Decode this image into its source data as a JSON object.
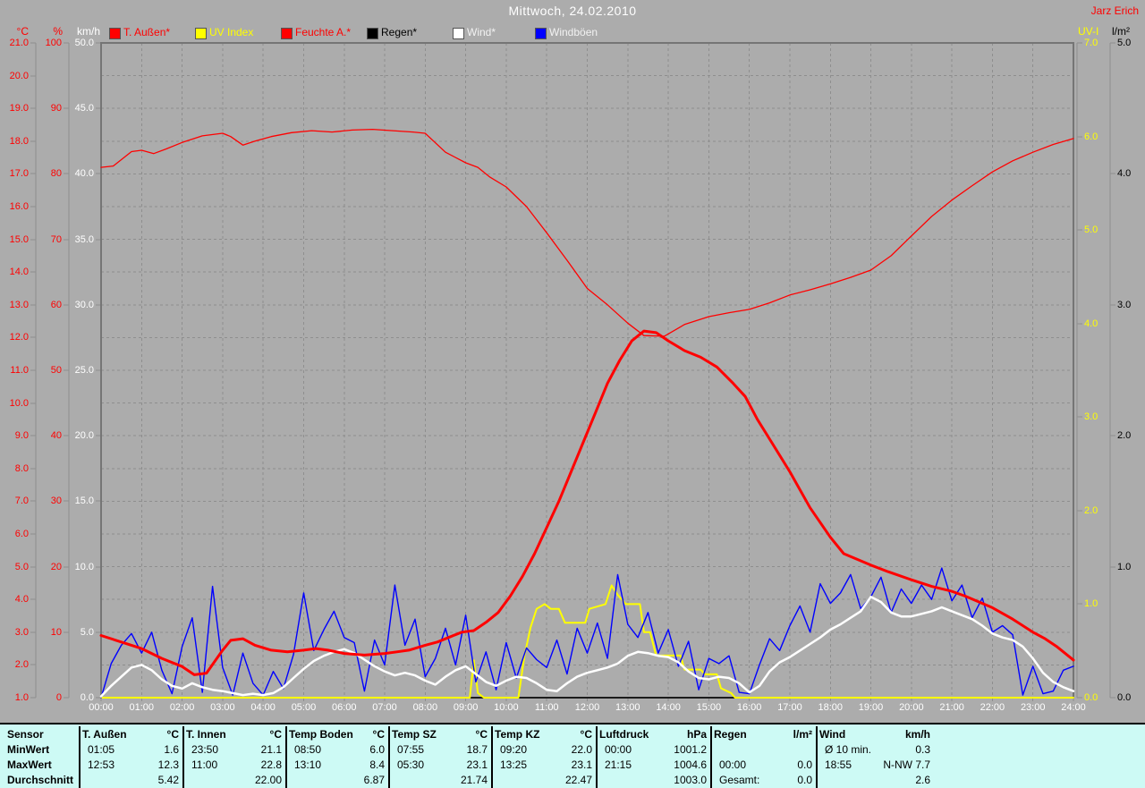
{
  "window": {
    "title": "Mittwoch, 24.02.2010",
    "author": "Jarz Erich"
  },
  "legend": {
    "items": [
      {
        "label": "T. Außen*",
        "swatch_color": "#ff0000",
        "text_color": "#ff0000"
      },
      {
        "label": "UV Index",
        "swatch_color": "#ffff00",
        "text_color": "#ffff00"
      },
      {
        "label": "Feuchte A.*",
        "swatch_color": "#ff0000",
        "text_color": "#ff0000"
      },
      {
        "label": "Regen*",
        "swatch_color": "#000000",
        "text_color": "#000000"
      },
      {
        "label": "Wind*",
        "swatch_color": "#ffffff",
        "text_color": "#f2f2f2"
      },
      {
        "label": "Windböen",
        "swatch_color": "#0000ff",
        "text_color": "#f2f2f2"
      }
    ]
  },
  "chart_data": {
    "type": "line",
    "title": "Mittwoch, 24.02.2010",
    "layout": {
      "plot_background": "#acacac",
      "grid": "dashed hourly x / 1-unit y",
      "legend_position": "top"
    },
    "x_axis": {
      "min": 0,
      "max": 24,
      "tick_labels": [
        "00:00",
        "01:00",
        "02:00",
        "03:00",
        "04:00",
        "05:00",
        "06:00",
        "07:00",
        "08:00",
        "09:00",
        "10:00",
        "11:00",
        "12:00",
        "13:00",
        "14:00",
        "15:00",
        "16:00",
        "17:00",
        "18:00",
        "19:00",
        "20:00",
        "21:00",
        "22:00",
        "23:00",
        "24:00"
      ]
    },
    "y_axes": [
      {
        "id": "temp_c",
        "unit": "°C",
        "side": "left",
        "min": 1,
        "max": 21,
        "step": 1,
        "decimals": 1,
        "color": "#ff0000"
      },
      {
        "id": "percent",
        "unit": "%",
        "side": "left",
        "min": 0,
        "max": 100,
        "step": 10,
        "decimals": 0,
        "color": "#ff0000"
      },
      {
        "id": "kmh",
        "unit": "km/h",
        "side": "left",
        "min": 0,
        "max": 50,
        "step": 5,
        "decimals": 1,
        "color": "#ffffff"
      },
      {
        "id": "uv",
        "unit": "UV-I",
        "side": "right",
        "min": 0,
        "max": 7,
        "step": 1,
        "decimals": 1,
        "color": "#ffff00"
      },
      {
        "id": "lm2",
        "unit": "l/m²",
        "side": "right",
        "min": 0,
        "max": 5,
        "step": 1,
        "decimals": 1,
        "color": "#000000"
      }
    ],
    "series": [
      {
        "name": "Regen",
        "axis": "lm2",
        "color": "#000000",
        "width": 1.5,
        "x": [
          0,
          24
        ],
        "values": [
          0,
          0
        ]
      },
      {
        "name": "UV Index",
        "axis": "uv",
        "color": "#ffff00",
        "width": 2,
        "x": [
          0,
          9.1,
          9.2,
          9.3,
          9.45,
          10.3,
          10.45,
          10.6,
          10.75,
          10.95,
          11.1,
          11.3,
          11.45,
          11.5,
          11.95,
          12.05,
          12.45,
          12.6,
          12.75,
          12.95,
          13.1,
          13.3,
          13.4,
          13.55,
          13.7,
          13.8,
          14.3,
          14.4,
          14.8,
          14.9,
          15.2,
          15.3,
          15.55,
          15.65,
          24
        ],
        "values": [
          0,
          0,
          0.4,
          0.05,
          0,
          0,
          0.45,
          0.75,
          0.95,
          1.0,
          0.95,
          0.95,
          0.8,
          0.8,
          0.8,
          0.95,
          1.0,
          1.2,
          1.1,
          1.0,
          1.0,
          1.0,
          0.7,
          0.7,
          0.45,
          0.45,
          0.45,
          0.3,
          0.3,
          0.25,
          0.25,
          0.1,
          0.05,
          0,
          0
        ]
      },
      {
        "name": "Windböen",
        "axis": "kmh",
        "color": "#0000ff",
        "width": 1.4,
        "x_start": 0,
        "x_step": 0.25,
        "values": [
          0.0,
          2.6,
          4.0,
          4.9,
          3.4,
          5.0,
          2.1,
          0.3,
          3.9,
          6.1,
          0.4,
          8.5,
          2.3,
          0.2,
          3.4,
          1.1,
          0.2,
          2.0,
          0.7,
          3.3,
          8.0,
          3.6,
          5.2,
          6.6,
          4.6,
          4.2,
          0.5,
          4.4,
          2.5,
          8.6,
          4.0,
          6.0,
          1.6,
          3.0,
          5.3,
          2.5,
          6.3,
          1.2,
          3.5,
          0.6,
          4.2,
          1.5,
          3.8,
          2.9,
          2.3,
          4.4,
          1.8,
          5.3,
          3.4,
          5.7,
          3.0,
          9.4,
          5.6,
          4.6,
          6.5,
          3.4,
          5.2,
          2.4,
          4.3,
          0.6,
          3.0,
          2.6,
          3.2,
          0.4,
          0.3,
          2.5,
          4.5,
          3.6,
          5.5,
          7.0,
          5.0,
          8.7,
          7.2,
          8.0,
          9.4,
          6.8,
          7.7,
          9.2,
          6.5,
          8.3,
          7.2,
          8.6,
          7.5,
          9.9,
          7.4,
          8.6,
          6.1,
          7.6,
          5.0,
          5.5,
          4.8,
          0.2,
          2.4,
          0.3,
          0.5,
          2.1,
          2.4
        ]
      },
      {
        "name": "Wind",
        "axis": "kmh",
        "color": "#ffffff",
        "width": 2.5,
        "x_start": 0,
        "x_step": 0.25,
        "values": [
          0.1,
          0.9,
          1.6,
          2.3,
          2.5,
          2.1,
          1.4,
          0.9,
          0.7,
          1.1,
          0.8,
          0.6,
          0.5,
          0.35,
          0.2,
          0.3,
          0.2,
          0.35,
          0.8,
          1.5,
          2.2,
          2.8,
          3.2,
          3.5,
          3.7,
          3.4,
          2.9,
          2.4,
          2.0,
          1.7,
          1.9,
          1.7,
          1.3,
          1.0,
          1.6,
          2.1,
          2.4,
          1.8,
          1.2,
          0.9,
          1.3,
          1.6,
          1.5,
          1.1,
          0.6,
          0.5,
          1.1,
          1.6,
          1.9,
          2.1,
          2.3,
          2.6,
          3.2,
          3.5,
          3.4,
          3.2,
          3.1,
          2.7,
          2.0,
          1.5,
          1.4,
          1.6,
          1.5,
          1.1,
          0.4,
          0.9,
          2.0,
          2.7,
          3.1,
          3.6,
          4.1,
          4.6,
          5.2,
          5.6,
          6.1,
          6.6,
          7.7,
          7.3,
          6.5,
          6.2,
          6.2,
          6.4,
          6.6,
          6.9,
          6.6,
          6.3,
          6.0,
          5.5,
          4.9,
          4.6,
          4.4,
          3.9,
          3.0,
          1.9,
          1.2,
          0.8,
          0.5
        ]
      },
      {
        "name": "Feuchte A.",
        "axis": "percent",
        "color": "#ff0000",
        "width": 1.3,
        "x": [
          0,
          0.3,
          0.75,
          1,
          1.3,
          1.6,
          2,
          2.5,
          3,
          3.2,
          3.5,
          3.8,
          4.2,
          4.7,
          5.2,
          5.7,
          6.2,
          6.7,
          7.2,
          7.7,
          8,
          8.5,
          9,
          9.3,
          9.6,
          10,
          10.5,
          11,
          11.5,
          12,
          12.5,
          13,
          13.4,
          13.9,
          14.4,
          15,
          15.5,
          16,
          16.5,
          17,
          17.5,
          18,
          18.5,
          19,
          19.5,
          20,
          20.5,
          21,
          21.5,
          22,
          22.5,
          23,
          23.5,
          24
        ],
        "values": [
          81,
          81.2,
          83.4,
          83.6,
          83.1,
          83.8,
          84.8,
          85.8,
          86.2,
          85.7,
          84.4,
          85,
          85.7,
          86.3,
          86.6,
          86.4,
          86.7,
          86.8,
          86.6,
          86.4,
          86.2,
          83.3,
          81.7,
          81,
          79.5,
          78,
          75,
          71,
          66.8,
          62.5,
          60,
          57.2,
          55.3,
          55.2,
          57,
          58.2,
          58.8,
          59.3,
          60.3,
          61.5,
          62.3,
          63.2,
          64.2,
          65.3,
          67.5,
          70.5,
          73.5,
          76,
          78.2,
          80.3,
          82,
          83.3,
          84.5,
          85.4
        ]
      },
      {
        "name": "T. Außen",
        "axis": "temp_c",
        "color": "#ff0000",
        "width": 3,
        "x": [
          0,
          0.5,
          1,
          1.5,
          2,
          2.3,
          2.6,
          3,
          3.2,
          3.5,
          3.8,
          4.2,
          4.6,
          5,
          5.3,
          5.6,
          6,
          6.5,
          7,
          7.3,
          7.6,
          8,
          8.3,
          8.6,
          8.9,
          9.2,
          9.5,
          9.8,
          10.1,
          10.4,
          10.7,
          11,
          11.3,
          11.6,
          11.9,
          12.2,
          12.5,
          12.8,
          13.1,
          13.4,
          13.7,
          14,
          14.4,
          14.8,
          15.2,
          15.6,
          15.9,
          16.2,
          16.55,
          17,
          17.5,
          18,
          18.33,
          19,
          19.42,
          20,
          20.5,
          21,
          21.33,
          22,
          22.5,
          23,
          23.3,
          23.6,
          24
        ],
        "values": [
          2.9,
          2.7,
          2.5,
          2.2,
          1.95,
          1.7,
          1.75,
          2.45,
          2.75,
          2.8,
          2.6,
          2.45,
          2.4,
          2.45,
          2.5,
          2.45,
          2.35,
          2.3,
          2.35,
          2.4,
          2.45,
          2.6,
          2.7,
          2.85,
          3.0,
          3.05,
          3.3,
          3.6,
          4.1,
          4.7,
          5.4,
          6.2,
          7.0,
          7.9,
          8.8,
          9.7,
          10.6,
          11.3,
          11.9,
          12.2,
          12.15,
          11.9,
          11.6,
          11.4,
          11.1,
          10.6,
          10.2,
          9.5,
          8.8,
          7.9,
          6.8,
          5.9,
          5.4,
          5.05,
          4.85,
          4.6,
          4.4,
          4.25,
          4.1,
          3.75,
          3.4,
          3.0,
          2.8,
          2.55,
          2.15
        ]
      }
    ]
  },
  "table": {
    "row_labels": [
      "Sensor",
      "MinWert",
      "MaxWert",
      "Durchschnitt"
    ],
    "columns": [
      {
        "name": "T. Außen",
        "unit": "°C",
        "min": [
          "01:05",
          "1.6"
        ],
        "max": [
          "12:53",
          "12.3"
        ],
        "avg": [
          "",
          "5.42"
        ]
      },
      {
        "name": "T. Innen",
        "unit": "°C",
        "min": [
          "23:50",
          "21.1"
        ],
        "max": [
          "11:00",
          "22.8"
        ],
        "avg": [
          "",
          "22.00"
        ]
      },
      {
        "name": "Temp Boden",
        "unit": "°C",
        "min": [
          "08:50",
          "6.0"
        ],
        "max": [
          "13:10",
          "8.4"
        ],
        "avg": [
          "",
          "6.87"
        ]
      },
      {
        "name": "Temp SZ",
        "unit": "°C",
        "min": [
          "07:55",
          "18.7"
        ],
        "max": [
          "05:30",
          "23.1"
        ],
        "avg": [
          "",
          "21.74"
        ]
      },
      {
        "name": "Temp KZ",
        "unit": "°C",
        "min": [
          "09:20",
          "22.0"
        ],
        "max": [
          "13:25",
          "23.1"
        ],
        "avg": [
          "",
          "22.47"
        ]
      },
      {
        "name": "Luftdruck",
        "unit": "hPa",
        "min": [
          "00:00",
          "1001.2"
        ],
        "max": [
          "21:15",
          "1004.6"
        ],
        "avg": [
          "",
          "1003.0"
        ]
      },
      {
        "name": "Regen",
        "unit": "l/m²",
        "min": [
          "",
          ""
        ],
        "max": [
          "00:00",
          "0.0"
        ],
        "avg": [
          "Gesamt:",
          "0.0"
        ]
      },
      {
        "name": "Wind",
        "unit": "km/h",
        "min": [
          "Ø 10 min.",
          "0.3"
        ],
        "max": [
          "18:55",
          "N-NW 7.7"
        ],
        "avg": [
          "",
          "2.6"
        ]
      }
    ]
  }
}
